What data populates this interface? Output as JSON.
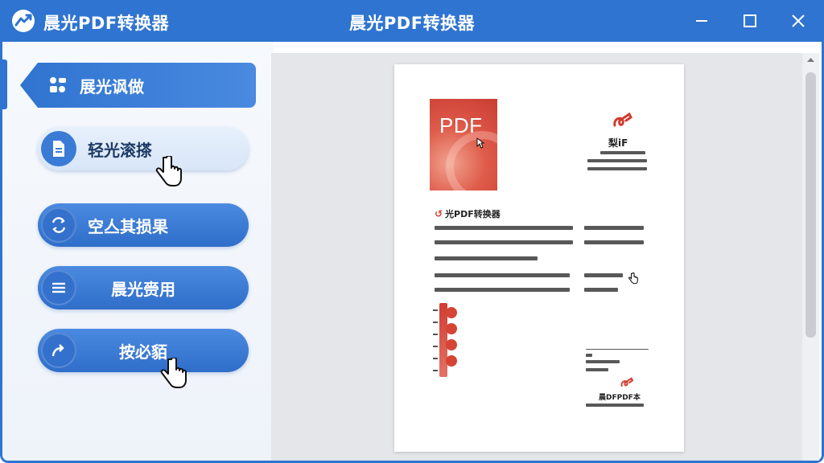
{
  "app": {
    "name": "晨光PDF转换器",
    "window_title": "晨光PDF转换器"
  },
  "window_controls": {
    "minimize_icon": "minimize-icon",
    "maximize_icon": "maximize-icon",
    "close_icon": "close-icon"
  },
  "sidebar": {
    "items": [
      {
        "label": "展光讽做",
        "icon": "users-grid-icon",
        "active": true
      },
      {
        "label": "轻光滚搽",
        "icon": "document-icon",
        "active": false
      },
      {
        "label": "空亼其损果",
        "icon": "convert-cycle-icon",
        "active": false
      },
      {
        "label": "晨光赍用",
        "icon": "sliders-icon",
        "active": false
      },
      {
        "label": "按必貊",
        "icon": "share-arrow-icon",
        "active": false
      }
    ]
  },
  "document": {
    "thumb_text": "PDF",
    "small_title": "梨iF",
    "heading": "光PDF转换器",
    "footer_title": "晨DFPDF本"
  },
  "colors": {
    "brand": "#2f74d0",
    "accent_red": "#d23b2f"
  }
}
